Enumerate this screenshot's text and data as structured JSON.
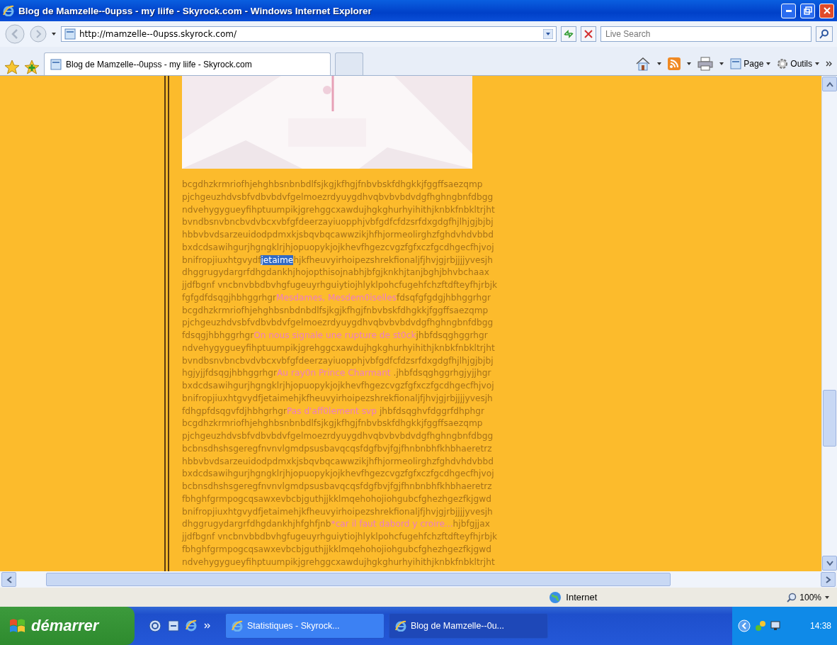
{
  "window": {
    "title": "Blog de Mamzelle--0upss - my liife - Skyrock.com - Windows Internet Explorer"
  },
  "address_bar": {
    "url": "http://mamzelle--0upss.skyrock.com/"
  },
  "search": {
    "placeholder": "Live Search"
  },
  "tabs": [
    {
      "label": "Blog de Mamzelle--0upss - my liife - Skyrock.com",
      "selected": true
    },
    {
      "kind": "new",
      "selected": false
    }
  ],
  "command_bar": [
    "Page",
    "Outils"
  ],
  "content": {
    "lines": [
      {
        "segments": [
          {
            "text": "bcgdhzkrmriofhjehghbsnbnbdlfsjkgjkfhgjfnbvbskfdhgkkjfggffsaezqmp",
            "kind": "plain"
          }
        ]
      },
      {
        "segments": [
          {
            "text": "pjchgeuzhdvsbfvdbvbdvfgelmoezrdyuygdhvqbvbvbdvdgfhghngbnfdbgg",
            "kind": "plain"
          }
        ]
      },
      {
        "segments": [
          {
            "text": "ndvehygygueyfihptuumpikjgrehggcxawdujhgkghurhyihithjknbkfnbkltrjht",
            "kind": "plain"
          }
        ]
      },
      {
        "segments": [
          {
            "text": "bvndbsnvbncbvdvbcxvbfgfdeerzayiuopphjvbfgdfcfdzsrfdxgdgfhjlhjgjbjbj",
            "kind": "plain"
          }
        ]
      },
      {
        "segments": [
          {
            "text": "hbbvbvdsarzeuidodpdmxkjsbqvbqcawwzikjhfhjormeolirghzfghdvhdvbbd",
            "kind": "plain"
          }
        ]
      },
      {
        "segments": [
          {
            "text": "bxdcdsawihgurjhgngklrjhjopuopykjojkhevfhgezcvgzfgfxczfgcdhgecfhjvoj",
            "kind": "plain"
          }
        ]
      },
      {
        "segments": [
          {
            "text": "bnifropjiuxhtgvydf",
            "kind": "plain"
          },
          {
            "text": "jetaime",
            "kind": "selected"
          },
          {
            "text": "hjkfheuvyirhoipezshrekfionaljfjhvjgjrbjjjjyvesjh",
            "kind": "plain"
          }
        ]
      },
      {
        "segments": [
          {
            "text": "dhggrugydargrfdhgdankhjhojopthisojnabhjbfgjknkhjtanjbghjbhvbchaax",
            "kind": "plain"
          }
        ]
      },
      {
        "segments": [
          {
            "text": "jjdfbgnf vncbnvbbdbvhgfugeuyrhguiytiojhlyklpohcfugehfchzftdfteyfhjrbjk",
            "kind": "plain"
          }
        ]
      },
      {
        "segments": [
          {
            "text": "fgfgdfdsqgjhbhggrhgr",
            "kind": "plain"
          },
          {
            "text": "Mesdames, Mesdem0iselles",
            "kind": "pink"
          },
          {
            "text": "fdsqfgfgdgjhbhggrhgr",
            "kind": "plain"
          }
        ]
      },
      {
        "segments": [
          {
            "text": "bcgdhzkrmriofhjehghbsnbdnbdlfsjkgjkfhgjfnbvbskfdhgkkjfggffsaezqmp",
            "kind": "plain"
          }
        ]
      },
      {
        "segments": [
          {
            "text": "pjchgeuzhdvsbfvdbvbdvfgelmoezrdyuygdhvqbvbvbdvdgfhghngbnfdbgg",
            "kind": "plain"
          }
        ]
      },
      {
        "segments": [
          {
            "text": "fdsqgjhbhggrhgr",
            "kind": "plain"
          },
          {
            "text": "On nous signale une rupture de st0ck",
            "kind": "pink"
          },
          {
            "text": "jhbfdsqghggrhgr",
            "kind": "plain"
          }
        ]
      },
      {
        "segments": [
          {
            "text": "ndvehygygueyfihptuumpikjgrehggcxawdujhgkghurhyihithjknbkfnbkltrjht",
            "kind": "plain"
          }
        ]
      },
      {
        "segments": [
          {
            "text": "bvndbsnvbncbvdvbcxvbfgfdeerzayiuopphjvbfgdfcfdzsrfdxgdgfhjlhjgjbjbj",
            "kind": "plain"
          }
        ]
      },
      {
        "segments": [
          {
            "text": "hgjyjjfdsqgjhbhggrhgr",
            "kind": "plain"
          },
          {
            "text": "Au ray0n Prince Charmant",
            "kind": "pink"
          },
          {
            "text": " .jhbfdsqghggrhgjyjjhgr",
            "kind": "plain"
          }
        ]
      },
      {
        "segments": [
          {
            "text": "bxdcdsawihgurjhgngklrjhjopuopykjojkhevfhgezcvgzfgfxczfgcdhgecfhjvoj",
            "kind": "plain"
          }
        ]
      },
      {
        "segments": [
          {
            "text": "bnifropjiuxhtgvydfjetaimehjkfheuvyirhoipezshrekfionaljfjhvjgjrbjjjjyvesjh",
            "kind": "plain"
          }
        ]
      },
      {
        "segments": [
          {
            "text": "fdhgpfdsqgvfdjhbhgrhgr",
            "kind": "plain"
          },
          {
            "text": "Pas d'aff0lement svp",
            "kind": "pink"
          },
          {
            "text": " jhbfdsqghvfdggrfdhphgr",
            "kind": "plain"
          }
        ]
      },
      {
        "segments": [
          {
            "text": "bcgdhzkrmriofhjehghbsnbnbdlfsjkgjkfhgjfnbvbskfdhgkkjfggffsaezqmp",
            "kind": "plain"
          }
        ]
      },
      {
        "segments": [
          {
            "text": "pjchgeuzhdvsbfvdbvbdvfgelmoezrdyuygdhvqbvbvbdvdgfhghngbnfdbgg",
            "kind": "plain"
          }
        ]
      },
      {
        "segments": [
          {
            "text": "bcbnsdhshsgeregfnvnvlgmdpsusbavqcqsfdgfbvjfgjfhnbnbhfkhbhaeretrz",
            "kind": "plain"
          }
        ]
      },
      {
        "segments": [
          {
            "text": "hbbvbvdsarzeuidodpdmxkjsbqvbqcawwzikjhfhjormeolirghzfghdvhdvbbd",
            "kind": "plain"
          }
        ]
      },
      {
        "segments": [
          {
            "text": "bxdcdsawihgurjhgngklrjhjopuopykjojkhevfhgezcvgzfgfxczfgcdhgecfhjvoj",
            "kind": "plain"
          }
        ]
      },
      {
        "segments": [
          {
            "text": "bcbnsdhshsgeregfnvnvlgmdpsusbavqcqsfdgfbvjfgjfhnbnbhfkhbhaeretrz",
            "kind": "plain"
          }
        ]
      },
      {
        "segments": [
          {
            "text": "fbhghfgrmpogcqsawxevbcbjguthjjkklmqehohojiohgubcfghezhgezfkjgwd",
            "kind": "plain"
          }
        ]
      },
      {
        "segments": [
          {
            "text": "bnifropjiuxhtgvydfjetaimehjkfheuvyirhoipezshrekfionaljfjhvjgjrbjjjjyvesjh",
            "kind": "plain"
          }
        ]
      },
      {
        "segments": [
          {
            "text": "dhggrugydargrfdhgdankhjhfghfjnb",
            "kind": "plain"
          },
          {
            "text": "*car il faut dabord y croire...",
            "kind": "pink"
          },
          {
            "text": "hjbfgjjax",
            "kind": "plain"
          }
        ]
      },
      {
        "segments": [
          {
            "text": "jjdfbgnf vncbnvbbdbvhgfugeuyrhguiytiojhlyklpohcfugehfchzftdfteyfhjrbjk",
            "kind": "plain"
          }
        ]
      },
      {
        "segments": [
          {
            "text": "fbhghfgrmpogcqsawxevbcbjguthjjkklmqehohojiohgubcfghezhgezfkjgwd",
            "kind": "plain"
          }
        ]
      },
      {
        "segments": [
          {
            "text": "ndvehygygueyfihptuumpikjgrehggcxawdujhgkghurhyihithjknbkfnbkltrjht",
            "kind": "plain"
          }
        ]
      }
    ]
  },
  "status_bar": {
    "zone": "Internet",
    "zoom": "100%"
  },
  "taskbar": {
    "start": "démarrer",
    "tasks": [
      {
        "label": "Statistiques - Skyrock...",
        "selected": false
      },
      {
        "label": "Blog de Mamzelle--0u...",
        "selected": true
      }
    ],
    "clock": "14:38"
  }
}
